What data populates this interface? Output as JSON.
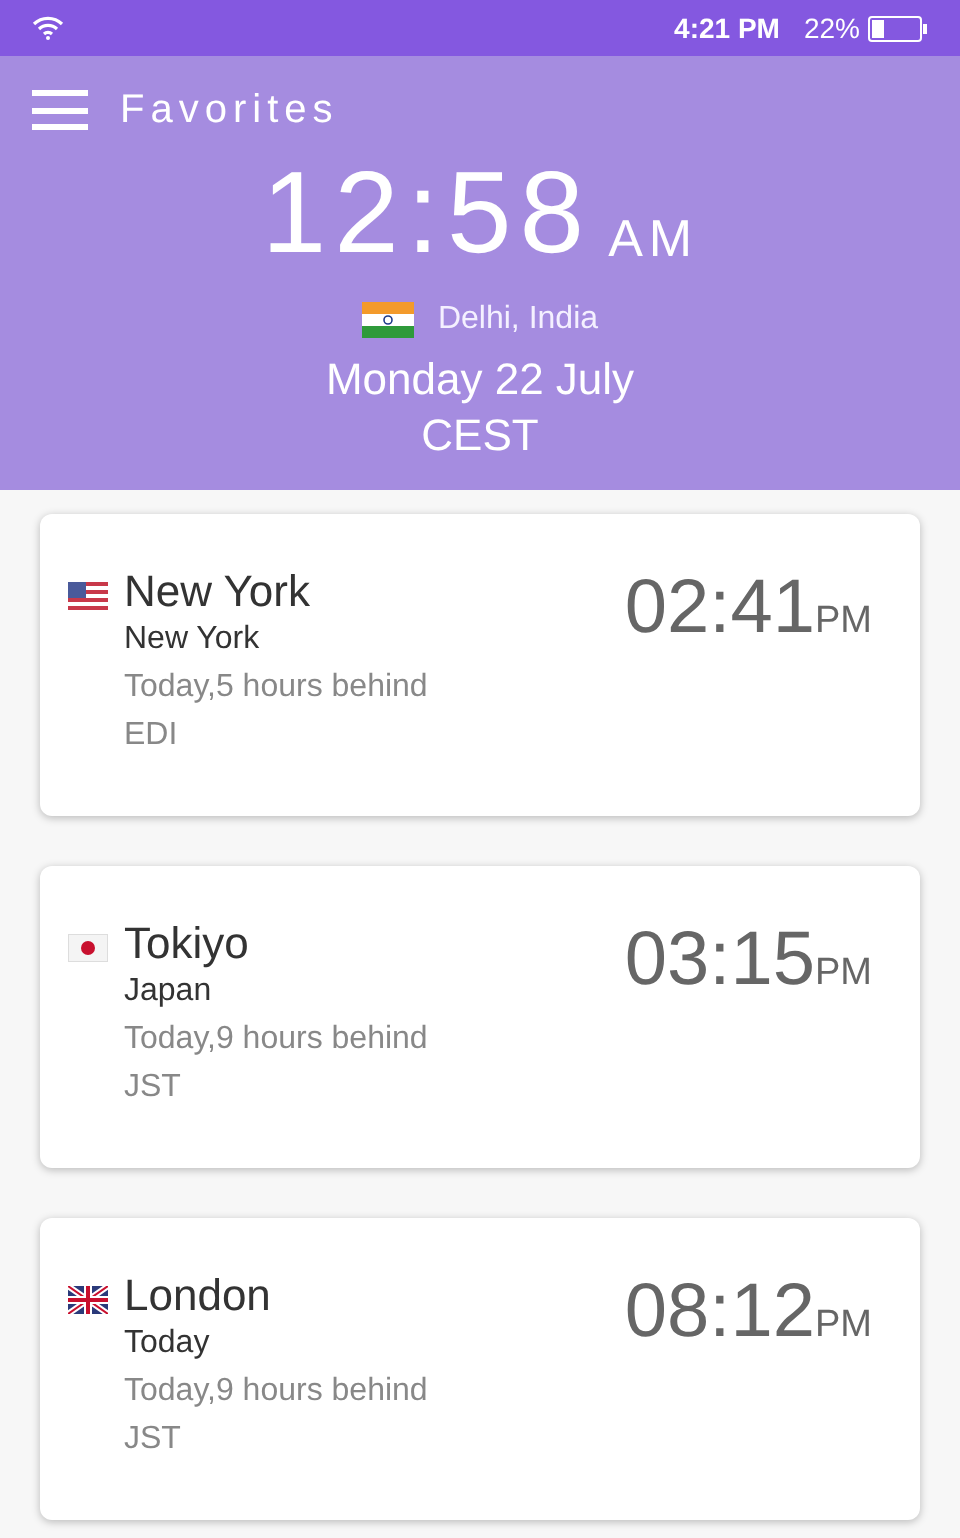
{
  "status_bar": {
    "time": "4:21 PM",
    "battery": "22%"
  },
  "header": {
    "title": "Favorites",
    "clock": "12:58",
    "meridiem": "AM",
    "location": "Delhi, India",
    "date": "Monday 22 July",
    "zone": "CEST"
  },
  "cities": [
    {
      "kind": "us",
      "name": "New York",
      "region": "New York",
      "offset": "Today,5 hours behind",
      "zone": "EDI",
      "time": "02:41",
      "meridiem": "PM"
    },
    {
      "kind": "jp",
      "name": "Tokiyo",
      "region": "Japan",
      "offset": "Today,9 hours behind",
      "zone": "JST",
      "time": "03:15",
      "meridiem": "PM"
    },
    {
      "kind": "uk",
      "name": "London",
      "region": "Today",
      "offset": "Today,9 hours behind",
      "zone": "JST",
      "time": "08:12",
      "meridiem": "PM"
    }
  ]
}
